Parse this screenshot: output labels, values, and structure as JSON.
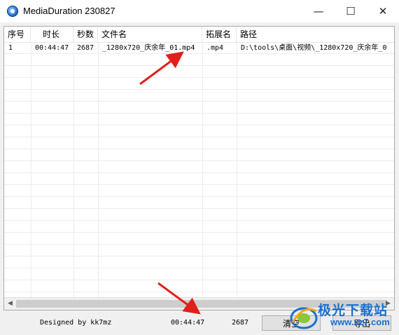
{
  "window": {
    "title": "MediaDuration 230827",
    "minimize": "—",
    "maximize": "☐",
    "close": "✕"
  },
  "table": {
    "columns": [
      "序号",
      "时长",
      "秒数",
      "文件名",
      "拓展名",
      "路径"
    ],
    "rows": [
      {
        "index": "1",
        "duration": "00:44:47",
        "seconds": "2687",
        "filename": "_1280x720_庆余年_01.mp4",
        "ext": ".mp4",
        "path": "D:\\tools\\桌面\\视频\\_1280x720_庆余年_0"
      }
    ]
  },
  "scrollbar": {
    "left_arrow": "◀",
    "right_arrow": "▶"
  },
  "footer": {
    "designer": "Designed by kk7mz",
    "total_duration": "00:44:47",
    "total_seconds": "2687",
    "clear_label": "清空",
    "export_label": "导出"
  },
  "watermark": {
    "text": "极光下载站",
    "url": "www.xz7.com"
  },
  "colors": {
    "annotation_arrow": "#e0201a",
    "watermark": "#1a6fd0"
  }
}
